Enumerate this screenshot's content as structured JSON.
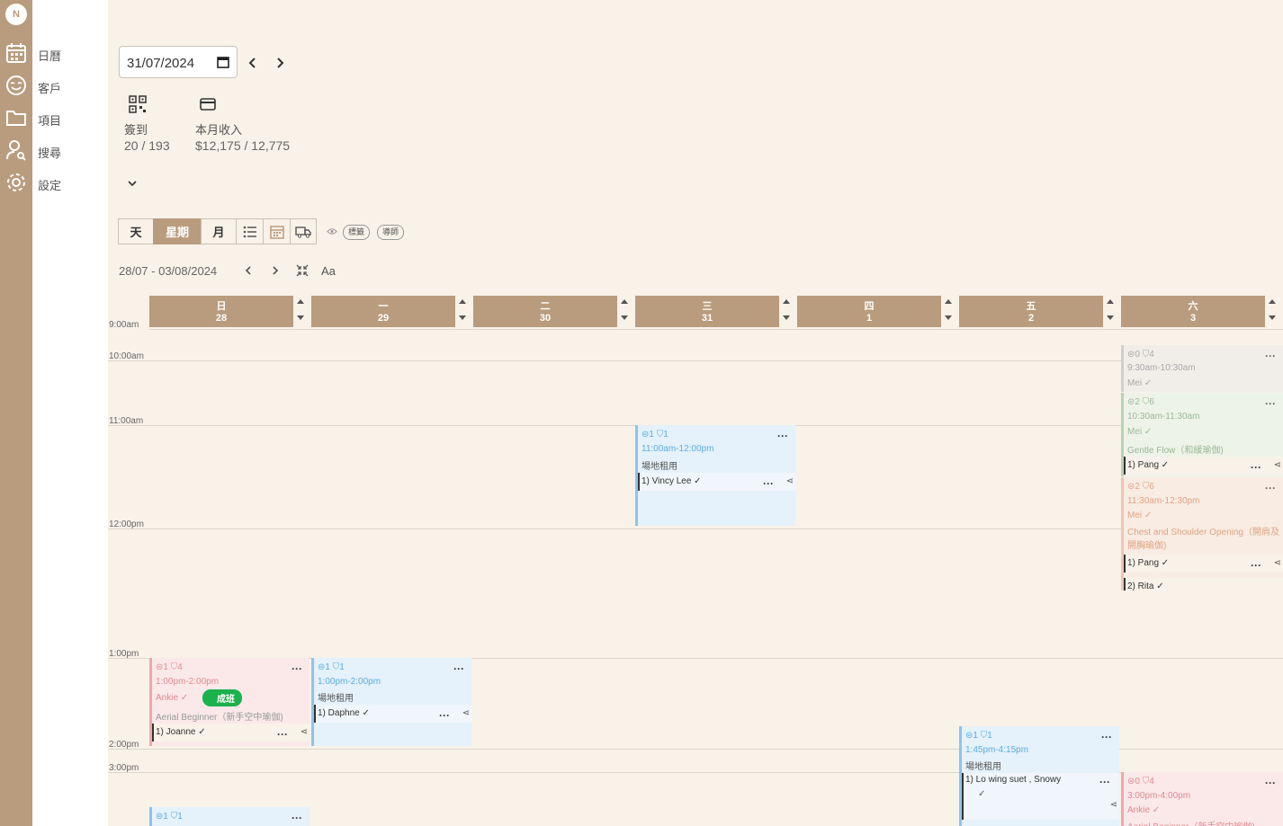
{
  "nav": {
    "logo": "N",
    "items": [
      {
        "label": "日曆"
      },
      {
        "label": "客戶"
      },
      {
        "label": "項目"
      },
      {
        "label": "搜尋"
      },
      {
        "label": "設定"
      }
    ]
  },
  "date_picker": {
    "value": "31/07/2024"
  },
  "stats": {
    "checkin": {
      "label": "簽到",
      "value": "20 / 193"
    },
    "income": {
      "label": "本月收入",
      "value": "$12,175 / 12,775"
    }
  },
  "views": [
    {
      "label": "天"
    },
    {
      "label": "星期",
      "active": true
    },
    {
      "label": "月"
    }
  ],
  "filters": {
    "tags": "標籤",
    "instructors": "導師"
  },
  "range": {
    "label": "28/07 - 03/08/2024",
    "font_toggle": "Aa"
  },
  "days": [
    {
      "weekday": "日",
      "date": "28"
    },
    {
      "weekday": "一",
      "date": "29"
    },
    {
      "weekday": "二",
      "date": "30"
    },
    {
      "weekday": "三",
      "date": "31"
    },
    {
      "weekday": "四",
      "date": "1"
    },
    {
      "weekday": "五",
      "date": "2"
    },
    {
      "weekday": "六",
      "date": "3"
    }
  ],
  "times": [
    "9:00am",
    "10:00am",
    "11:00am",
    "12:00pm",
    "1:00pm",
    "2:00pm",
    "3:00pm"
  ],
  "events": {
    "sat_930": {
      "meta": "⊜0  ⛉4",
      "time": "9:30am-10:30am",
      "instructor": "Mei  ✓"
    },
    "sat_1030": {
      "meta": "⊜2  ⛉6",
      "time": "10:30am-11:30am",
      "instructor": "Mei  ✓",
      "title": "Gentle Flow（和緩瑜伽)",
      "booking": "1)  Pang  ✓"
    },
    "sat_1130": {
      "meta": "⊜2  ⛉6",
      "time": "11:30am-12:30pm",
      "instructor": "Mei  ✓",
      "title": "Chest and Shoulder Opening（開肩及開胸瑜伽)",
      "booking": "1)  Pang  ✓",
      "booking2": "2)  Rita  ✓"
    },
    "wed_11": {
      "meta": "⊜1  ⛉1",
      "time": "11:00am-12:00pm",
      "title": "場地租用",
      "booking": "1) Vincy Lee  ✓"
    },
    "sun_1": {
      "meta": "⊜1  ⛉4",
      "time": "1:00pm-2:00pm",
      "instructor": "Ankie  ✓",
      "badge": "成班",
      "title": "Aerial Beginner（新手空中瑜伽)",
      "booking": "1)  Joanne  ✓"
    },
    "mon_1": {
      "meta": "⊜1  ⛉1",
      "time": "1:00pm-2:00pm",
      "title": "場地租用",
      "booking": "1)  Daphne  ✓"
    },
    "fri_145": {
      "meta": "⊜1  ⛉1",
      "time": "1:45pm-4:15pm",
      "title": "場地租用",
      "booking": "1) Lo wing suet , Snowy",
      "booking_check": "✓"
    },
    "sat_3": {
      "meta": "⊜0  ⛉4",
      "time": "3:00pm-4:00pm",
      "instructor": "Ankie  ✓",
      "title": "Aerial Beginner（新手空中瑜伽)"
    },
    "sun_3": {
      "meta": "⊜1  ⛉1"
    }
  },
  "colors": {
    "brand": "#b99c7d",
    "background": "#f8f2e8"
  }
}
